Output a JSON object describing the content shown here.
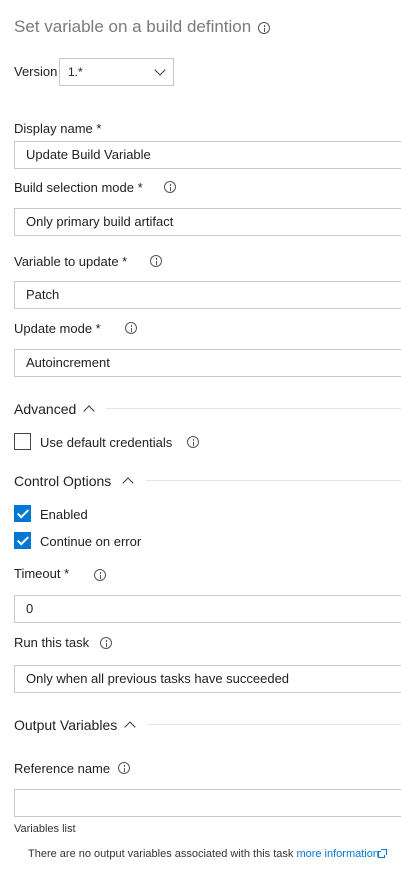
{
  "header": {
    "title": "Set variable on a build defintion"
  },
  "version": {
    "label": "Version",
    "value": "1.*"
  },
  "fields": {
    "display_name": {
      "label": "Display name *",
      "value": "Update Build Variable"
    },
    "build_selection_mode": {
      "label": "Build selection mode *",
      "value": "Only primary build artifact"
    },
    "variable_to_update": {
      "label": "Variable to update *",
      "value": "Patch"
    },
    "update_mode": {
      "label": "Update mode *",
      "value": "Autoincrement"
    }
  },
  "advanced": {
    "title": "Advanced",
    "use_default_credentials": {
      "label": "Use default credentials",
      "checked": false
    }
  },
  "control_options": {
    "title": "Control Options",
    "enabled": {
      "label": "Enabled",
      "checked": true
    },
    "continue_on_error": {
      "label": "Continue on error",
      "checked": true
    },
    "timeout": {
      "label": "Timeout *",
      "value": "0"
    },
    "run_this_task": {
      "label": "Run this task",
      "value": "Only when all previous tasks have succeeded"
    }
  },
  "output_variables": {
    "title": "Output Variables",
    "reference_name": {
      "label": "Reference name",
      "value": ""
    },
    "variables_list_label": "Variables list",
    "empty_message": "There are no output variables associated with this task",
    "more_info_link": "more information"
  },
  "colors": {
    "accent": "#0078d4",
    "border": "#c8c8c8",
    "title": "#7a7a7a"
  }
}
